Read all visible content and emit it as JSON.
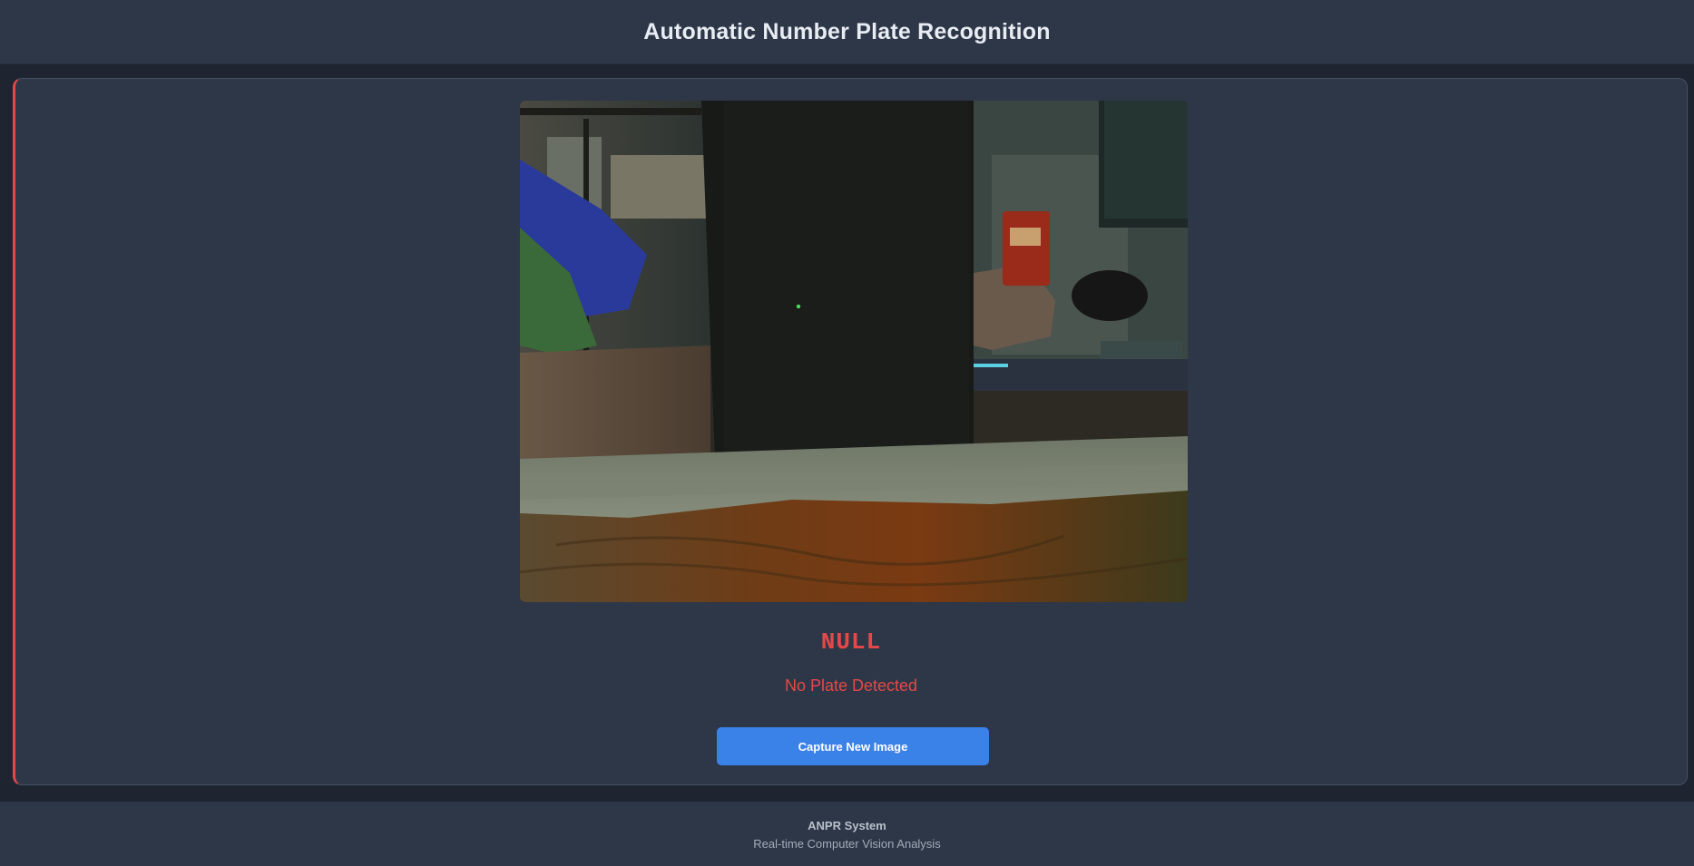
{
  "header": {
    "title": "Automatic Number Plate Recognition"
  },
  "result": {
    "plate_text": "NULL",
    "status_text": "No Plate Detected"
  },
  "actions": {
    "capture_label": "Capture New Image"
  },
  "footer": {
    "title": "ANPR System",
    "subtitle": "Real-time Computer Vision Analysis"
  },
  "colors": {
    "page_bg": "#1e2530",
    "panel_bg": "#2e3747",
    "error_accent": "#e54848",
    "primary_button": "#3b82e8"
  }
}
